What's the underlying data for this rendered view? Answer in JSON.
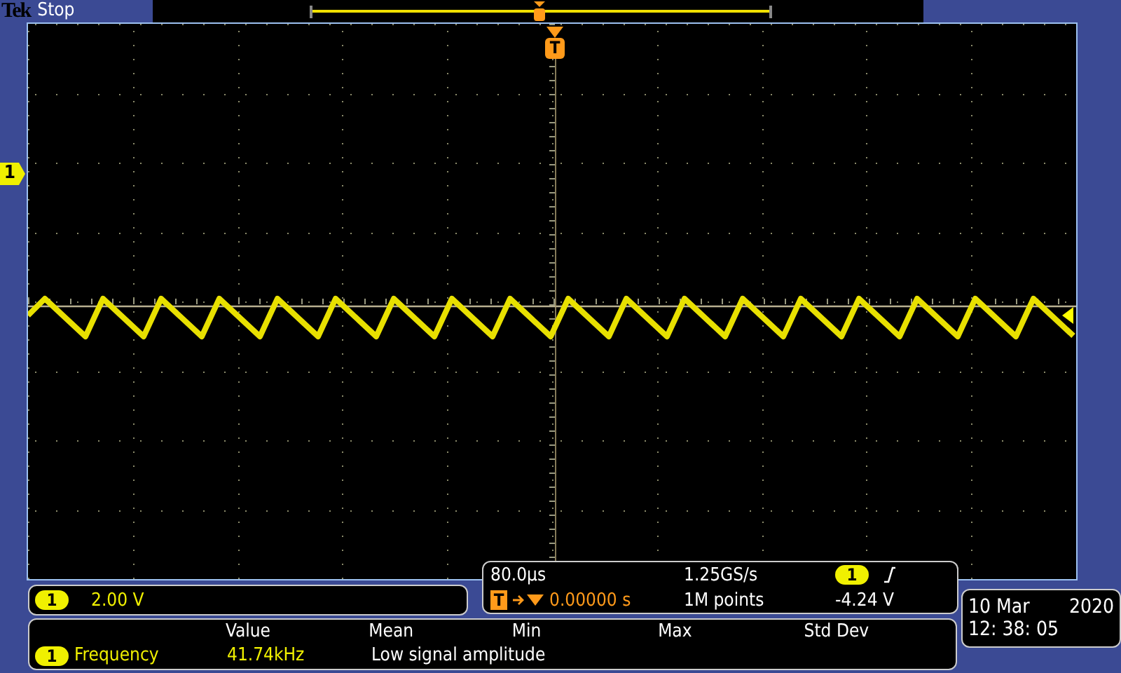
{
  "brand": "Tek",
  "acq_state": "Stop",
  "trigger_marker": "T",
  "channel_marker": "1",
  "channel": {
    "number": "1",
    "scale": "2.00 V"
  },
  "timebase": {
    "scale": "80.0µs",
    "trigger_symbol": "T",
    "delay": "0.00000 s",
    "sample_rate": "1.25GS/s",
    "record_length": "1M points",
    "trigger_source": "1",
    "trigger_level": "-4.24 V"
  },
  "measurements": {
    "columns": [
      "Value",
      "Mean",
      "Min",
      "Max",
      "Std Dev"
    ],
    "rows": [
      {
        "source": "1",
        "name": "Frequency",
        "value": "41.74kHz",
        "note": "Low signal amplitude"
      }
    ]
  },
  "clock": {
    "date": "10 Mar",
    "year": "2020",
    "time": "12: 38: 05"
  }
}
